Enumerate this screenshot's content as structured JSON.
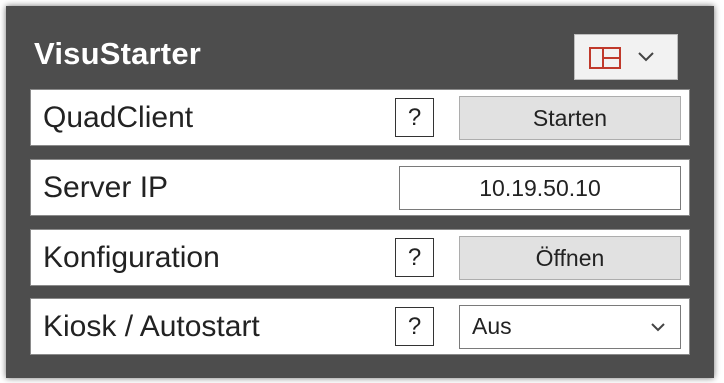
{
  "app": {
    "title": "VisuStarter"
  },
  "layout_button": {
    "icon": "layout-grid-icon",
    "icon_color": "#c0392b"
  },
  "rows": [
    {
      "label": "QuadClient",
      "help": "?",
      "action_label": "Starten"
    },
    {
      "label": "Server IP",
      "ip_value": "10.19.50.10"
    },
    {
      "label": "Konfiguration",
      "help": "?",
      "action_label": "Öffnen"
    },
    {
      "label": "Kiosk / Autostart",
      "help": "?",
      "select_value": "Aus"
    }
  ],
  "colors": {
    "window_bg": "#4d4d4d",
    "row_bg": "#ffffff",
    "button_bg": "#e1e1e1"
  }
}
